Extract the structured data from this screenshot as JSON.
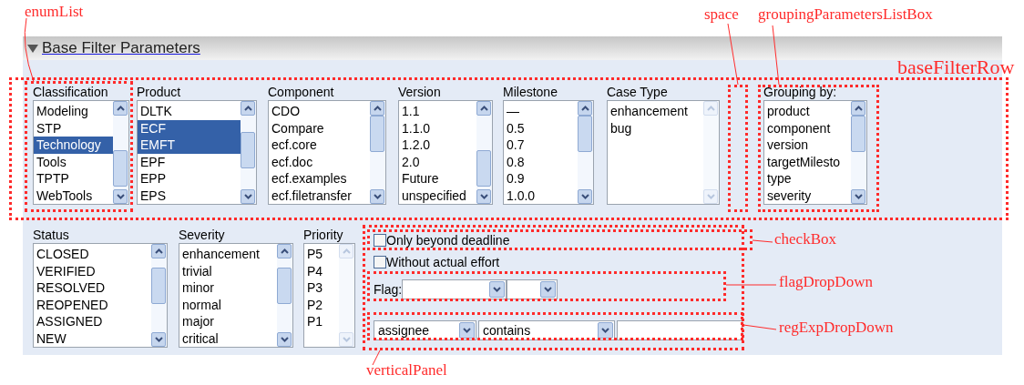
{
  "annotations": [
    {
      "text": "enumList"
    },
    {
      "text": "space"
    },
    {
      "text": "groupingParametersListBox"
    },
    {
      "text": "baseFilterRow"
    },
    {
      "text": "checkBox"
    },
    {
      "text": "flagDropDown"
    },
    {
      "text": "regExpDropDown"
    },
    {
      "text": "verticalPanel"
    }
  ],
  "section": {
    "title": "Base Filter Parameters",
    "expanded": true
  },
  "base_filter_row": [
    {
      "label": "Classification",
      "scrollable": true,
      "items": [
        {
          "text": "Modeling",
          "selected": false
        },
        {
          "text": "STP",
          "selected": false
        },
        {
          "text": "Technology",
          "selected": true
        },
        {
          "text": "Tools",
          "selected": false
        },
        {
          "text": "TPTP",
          "selected": false
        },
        {
          "text": "WebTools",
          "selected": false
        }
      ]
    },
    {
      "label": "Product",
      "scrollable": true,
      "items": [
        {
          "text": "DLTK",
          "selected": false
        },
        {
          "text": "ECF",
          "selected": true
        },
        {
          "text": "EMFT",
          "selected": true
        },
        {
          "text": "EPF",
          "selected": false
        },
        {
          "text": "EPP",
          "selected": false
        },
        {
          "text": "EPS",
          "selected": false
        }
      ]
    },
    {
      "label": "Component",
      "scrollable": true,
      "items": [
        {
          "text": "CDO",
          "selected": false
        },
        {
          "text": "Compare",
          "selected": false
        },
        {
          "text": "ecf.core",
          "selected": false
        },
        {
          "text": "ecf.doc",
          "selected": false
        },
        {
          "text": "ecf.examples",
          "selected": false
        },
        {
          "text": "ecf.filetransfer",
          "selected": false
        }
      ]
    },
    {
      "label": "Version",
      "scrollable": true,
      "items": [
        {
          "text": "1.1",
          "selected": false
        },
        {
          "text": "1.1.0",
          "selected": false
        },
        {
          "text": "1.2.0",
          "selected": false
        },
        {
          "text": "2.0",
          "selected": false
        },
        {
          "text": "Future",
          "selected": false
        },
        {
          "text": "unspecified",
          "selected": false
        }
      ]
    },
    {
      "label": "Milestone",
      "scrollable": true,
      "items": [
        {
          "text": "—",
          "selected": false
        },
        {
          "text": "0.5",
          "selected": false
        },
        {
          "text": "0.7",
          "selected": false
        },
        {
          "text": "0.8",
          "selected": false
        },
        {
          "text": "0.9",
          "selected": false
        },
        {
          "text": "1.0.0",
          "selected": false
        }
      ]
    },
    {
      "label": "Case Type",
      "scrollable": false,
      "items": [
        {
          "text": "enhancement",
          "selected": false
        },
        {
          "text": "bug",
          "selected": false
        }
      ]
    },
    {
      "label": "Grouping by:",
      "scrollable": true,
      "items": [
        {
          "text": "product",
          "selected": false
        },
        {
          "text": "component",
          "selected": false
        },
        {
          "text": "version",
          "selected": false
        },
        {
          "text": "targetMilesto",
          "selected": false
        },
        {
          "text": "type",
          "selected": false
        },
        {
          "text": "severity",
          "selected": false
        }
      ]
    }
  ],
  "second_row": [
    {
      "label": "Status",
      "scrollable": true,
      "items": [
        {
          "text": "CLOSED",
          "selected": false
        },
        {
          "text": "VERIFIED",
          "selected": false
        },
        {
          "text": "RESOLVED",
          "selected": false
        },
        {
          "text": "REOPENED",
          "selected": false
        },
        {
          "text": "ASSIGNED",
          "selected": false
        },
        {
          "text": "NEW",
          "selected": false
        }
      ]
    },
    {
      "label": "Severity",
      "scrollable": true,
      "items": [
        {
          "text": "enhancement",
          "selected": false
        },
        {
          "text": "trivial",
          "selected": false
        },
        {
          "text": "minor",
          "selected": false
        },
        {
          "text": "normal",
          "selected": false
        },
        {
          "text": "major",
          "selected": false
        },
        {
          "text": "critical",
          "selected": false
        }
      ]
    },
    {
      "label": "Priority",
      "scrollable": false,
      "items": [
        {
          "text": "P5",
          "selected": false
        },
        {
          "text": "P4",
          "selected": false
        },
        {
          "text": "P3",
          "selected": false
        },
        {
          "text": "P2",
          "selected": false
        },
        {
          "text": "P1",
          "selected": false
        }
      ]
    }
  ],
  "checkboxes": [
    {
      "label": "Only beyond deadline",
      "checked": false
    },
    {
      "label": "Without actual effort",
      "checked": false
    }
  ],
  "flag": {
    "label": "Flag:"
  },
  "regexp": {
    "field": "assignee",
    "operator": "contains"
  }
}
